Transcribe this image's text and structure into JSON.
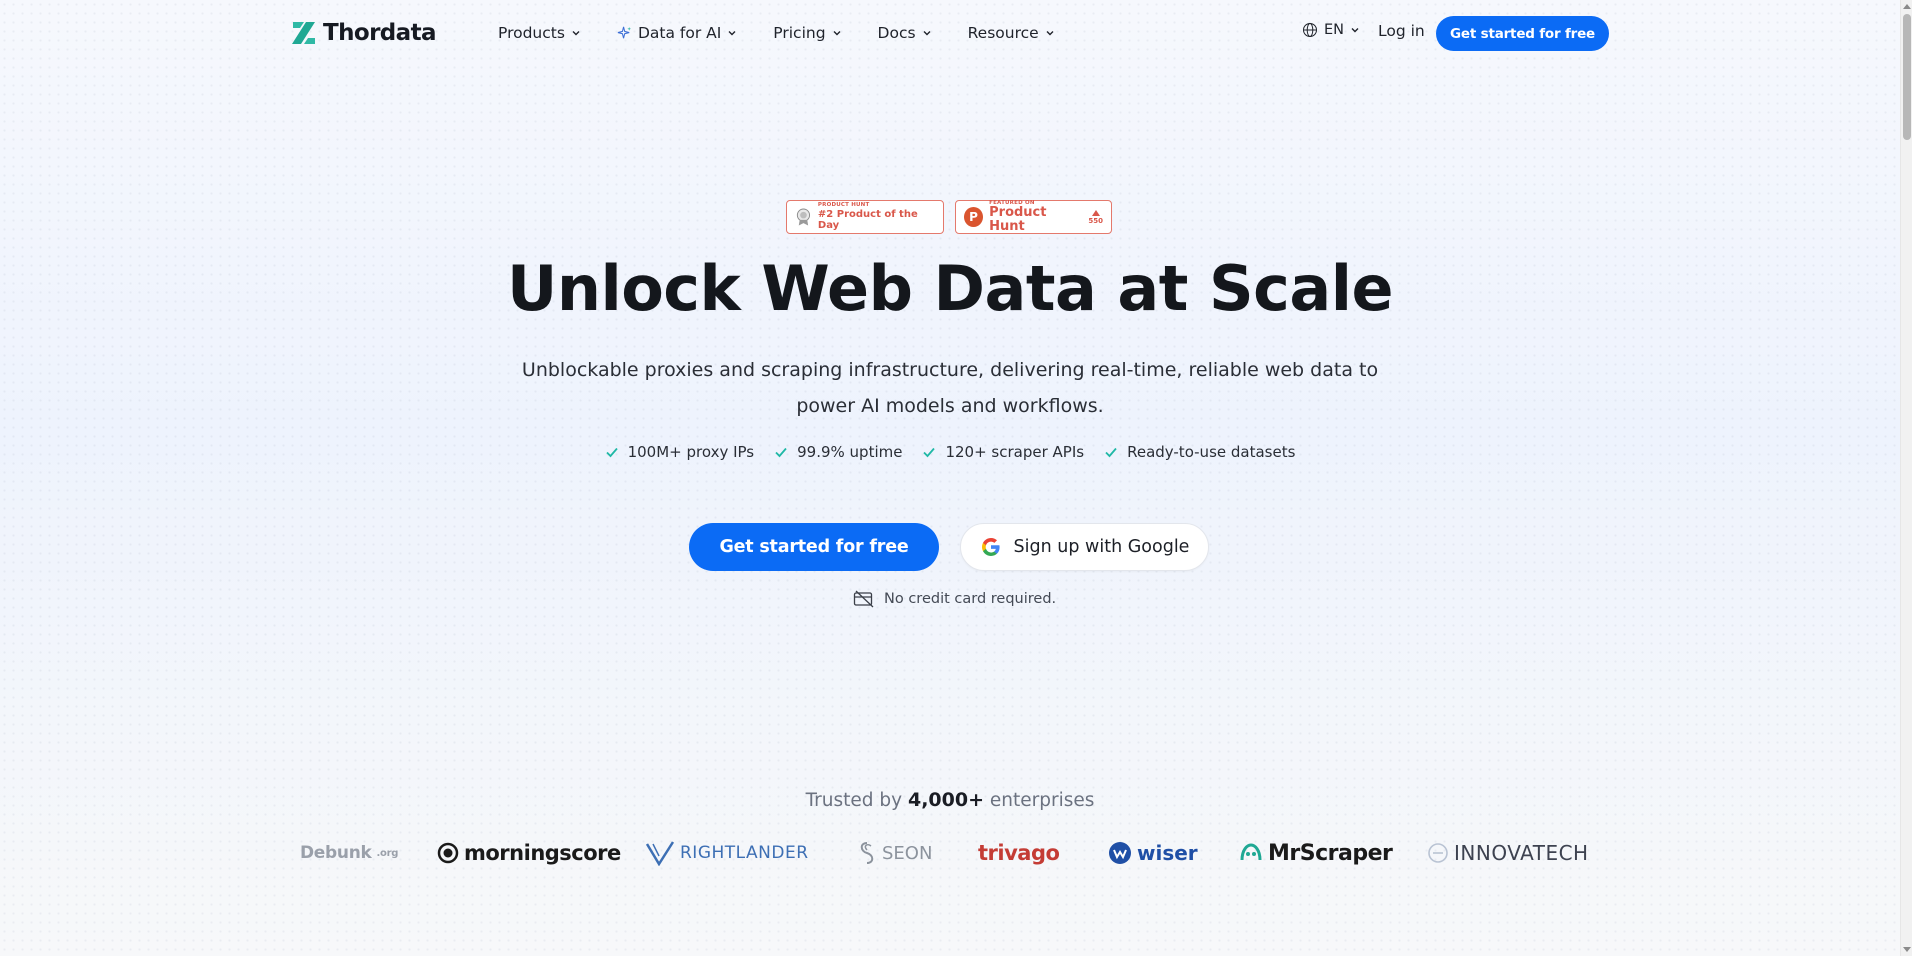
{
  "header": {
    "logo_text": "Thordata",
    "menu": [
      {
        "label": "Products",
        "has_spark": false
      },
      {
        "label": "Data for AI",
        "has_spark": true
      },
      {
        "label": "Pricing",
        "has_spark": false
      },
      {
        "label": "Docs",
        "has_spark": false
      },
      {
        "label": "Resource",
        "has_spark": false
      }
    ],
    "language": "EN",
    "login_label": "Log in",
    "cta_label": "Get started for free"
  },
  "hero": {
    "badges": {
      "product_of_day": {
        "top": "PRODUCT HUNT",
        "main": "#2 Product of the Day"
      },
      "featured": {
        "top": "FEATURED ON",
        "main": "Product Hunt",
        "votes": "550"
      }
    },
    "title": "Unlock Web Data at Scale",
    "subtitle": "Unblockable proxies and scraping infrastructure, delivering real-time, reliable web data to power AI models and workflows.",
    "features": [
      "100M+ proxy IPs",
      "99.9% uptime",
      "120+ scraper APIs",
      "Ready-to-use datasets"
    ],
    "primary_cta": "Get started for free",
    "google_cta": "Sign up with Google",
    "note": "No credit card required."
  },
  "trusted": {
    "prefix": "Trusted by",
    "count": "4,000+",
    "suffix": "enterprises",
    "brands": {
      "debunk": {
        "main": "Debunk",
        "suffix": ".org"
      },
      "morningscore": "morningscore",
      "rightlander": "RIGHTLANDER",
      "seon": "SEON",
      "trivago": "trivago",
      "wiser": "wiser",
      "mrscraper": "MrScraper",
      "innovatech": "INNOVATECH"
    }
  },
  "colors": {
    "accent": "#0b6bf5",
    "check": "#1fb8a6",
    "product_hunt": "#da552f"
  },
  "icons": [
    "thordata-logo-icon",
    "chevron-down-icon",
    "sparkle-icon",
    "globe-icon",
    "check-icon",
    "google-icon",
    "credit-card-off-icon",
    "product-hunt-icon",
    "medal-icon",
    "upvote-icon"
  ]
}
